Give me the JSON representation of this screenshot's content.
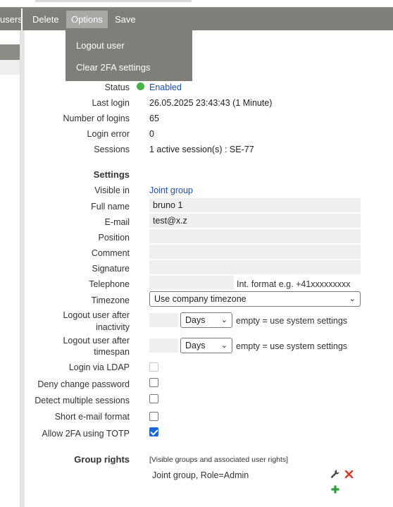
{
  "toolbar": {
    "left_fragment": "users",
    "delete_label": "Delete",
    "options_label": "Options",
    "save_label": "Save"
  },
  "options_menu": {
    "items": [
      {
        "label": "Logout user"
      },
      {
        "label": "Clear 2FA settings"
      }
    ]
  },
  "info": {
    "status_label": "Status",
    "status_value": "Enabled",
    "last_login_label": "Last login",
    "last_login_value": "26.05.2025 23:43:43 (1 Minute)",
    "number_of_logins_label": "Number of logins",
    "number_of_logins_value": "65",
    "login_error_label": "Login error",
    "login_error_value": "0",
    "sessions_label": "Sessions",
    "sessions_value": "1 active session(s) : SE-77"
  },
  "settings": {
    "heading": "Settings",
    "visible_in_label": "Visible in",
    "visible_in_value": "Joint group",
    "full_name_label": "Full name",
    "full_name_value": "bruno 1",
    "email_label": "E-mail",
    "email_value": "test@x.z",
    "position_label": "Position",
    "position_value": "",
    "comment_label": "Comment",
    "comment_value": "",
    "signature_label": "Signature",
    "signature_value": "",
    "telephone_label": "Telephone",
    "telephone_value": "",
    "telephone_hint": "Int. format e.g. +41xxxxxxxxx",
    "timezone_label": "Timezone",
    "timezone_value": "Use company timezone",
    "logout_inactivity_label_1": "Logout user after",
    "logout_inactivity_label_2": "inactivity",
    "logout_inactivity_value": "",
    "logout_inactivity_unit": "Days",
    "logout_inactivity_hint": "empty = use system settings",
    "logout_timespan_label_1": "Logout user after",
    "logout_timespan_label_2": "timespan",
    "logout_timespan_value": "",
    "logout_timespan_unit": "Days",
    "logout_timespan_hint": "empty = use system settings",
    "login_ldap_label": "Login via LDAP",
    "login_ldap_checked": false,
    "deny_change_password_label": "Deny change password",
    "deny_change_password_checked": false,
    "detect_multiple_sessions_label": "Detect multiple sessions",
    "detect_multiple_sessions_checked": false,
    "short_email_label": "Short e-mail format",
    "short_email_checked": false,
    "allow_2fa_label": "Allow 2FA using TOTP",
    "allow_2fa_checked": true
  },
  "group_rights": {
    "heading": "Group rights",
    "note": "[Visible groups and associated user rights]",
    "items": [
      {
        "text": "Joint group, Role=Admin"
      }
    ]
  },
  "colors": {
    "toolbar": "#7f7f79",
    "link": "#1a4fb0",
    "status_ok": "#43b34a",
    "checkbox_checked": "#1a66d2",
    "delete_icon": "#e0322b",
    "add_icon": "#2f9e3a"
  },
  "icons": {
    "edit": "wrench-icon",
    "remove": "close-icon",
    "add": "plus-icon"
  }
}
